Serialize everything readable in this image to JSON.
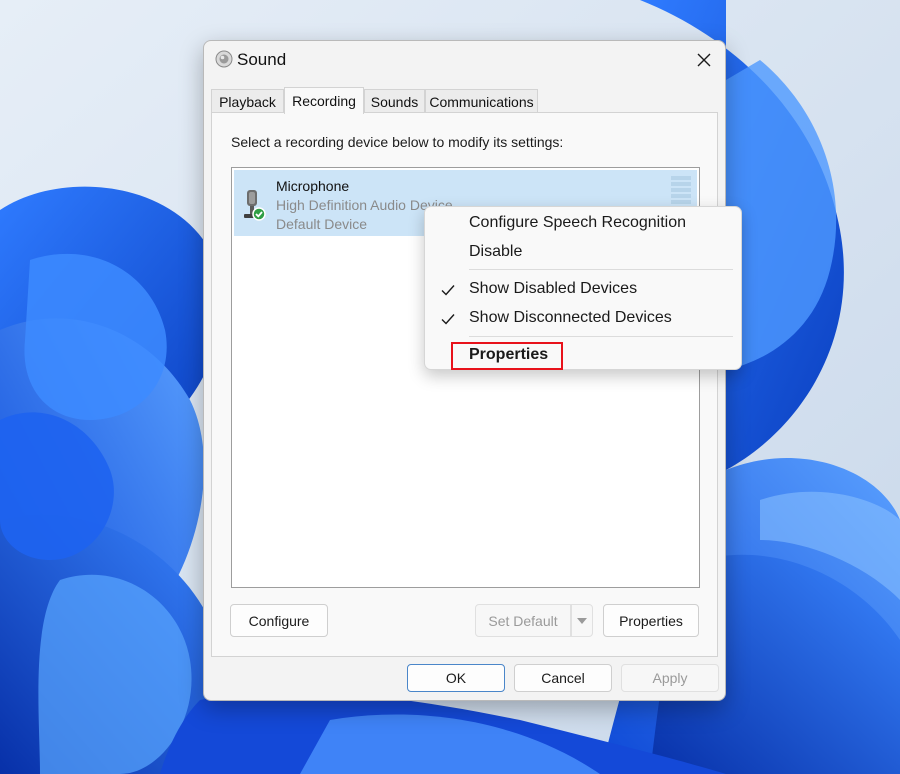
{
  "window": {
    "title": "Sound"
  },
  "tabs": [
    {
      "label": "Playback"
    },
    {
      "label": "Recording"
    },
    {
      "label": "Sounds"
    },
    {
      "label": "Communications"
    }
  ],
  "recording": {
    "instruction": "Select a recording device below to modify its settings:",
    "devices": [
      {
        "name": "Microphone",
        "driver": "High Definition Audio Device",
        "status": "Default Device"
      }
    ]
  },
  "buttons": {
    "configure": "Configure",
    "set_default": "Set Default",
    "properties": "Properties",
    "ok": "OK",
    "cancel": "Cancel",
    "apply": "Apply"
  },
  "context_menu": {
    "items": [
      {
        "label": "Configure Speech Recognition"
      },
      {
        "label": "Disable"
      },
      {
        "label": "Show Disabled Devices",
        "checked": true
      },
      {
        "label": "Show Disconnected Devices",
        "checked": true
      },
      {
        "label": "Properties",
        "highlighted": true
      }
    ]
  },
  "colors": {
    "selection": "#cce4f7",
    "highlight_outline": "#e8121b",
    "status_green": "#2f9e44",
    "wallpaper_blue": "#1459e0"
  }
}
